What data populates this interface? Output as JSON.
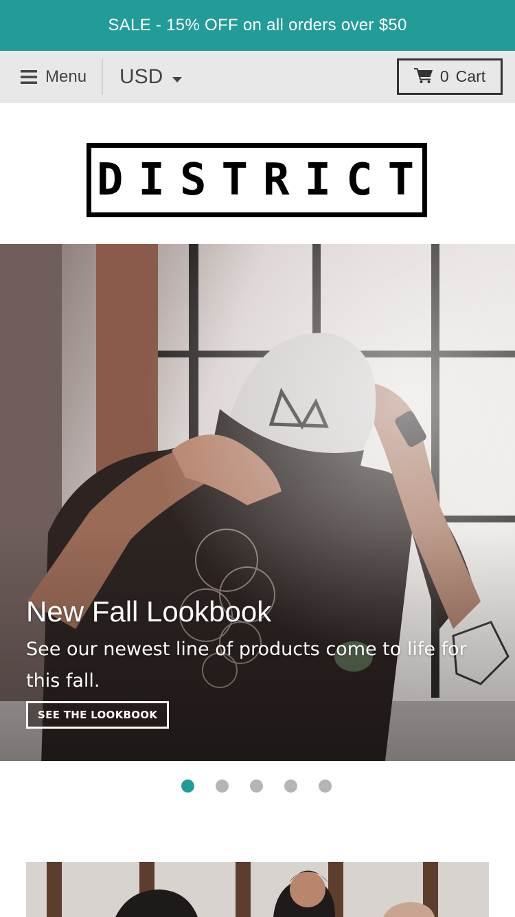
{
  "announcement": {
    "text": "SALE - 15% OFF on all orders over $50"
  },
  "colors": {
    "accent": "#229c99",
    "toolbar_bg": "#e8e8e8"
  },
  "toolbar": {
    "menu_icon": "hamburger-icon",
    "menu_label": "Menu",
    "currency_selected": "USD",
    "currency_icon": "caret-down-icon",
    "cart_icon": "shopping-cart-icon",
    "cart_count": "0",
    "cart_label": "Cart"
  },
  "logo": {
    "text": "DISTRICT"
  },
  "hero": {
    "title": "New Fall Lookbook",
    "text": "See our newest line of products come to life for this fall.",
    "cta": "SEE THE LOOKBOOK"
  },
  "slider": {
    "slides": 5,
    "active_index": 0
  }
}
